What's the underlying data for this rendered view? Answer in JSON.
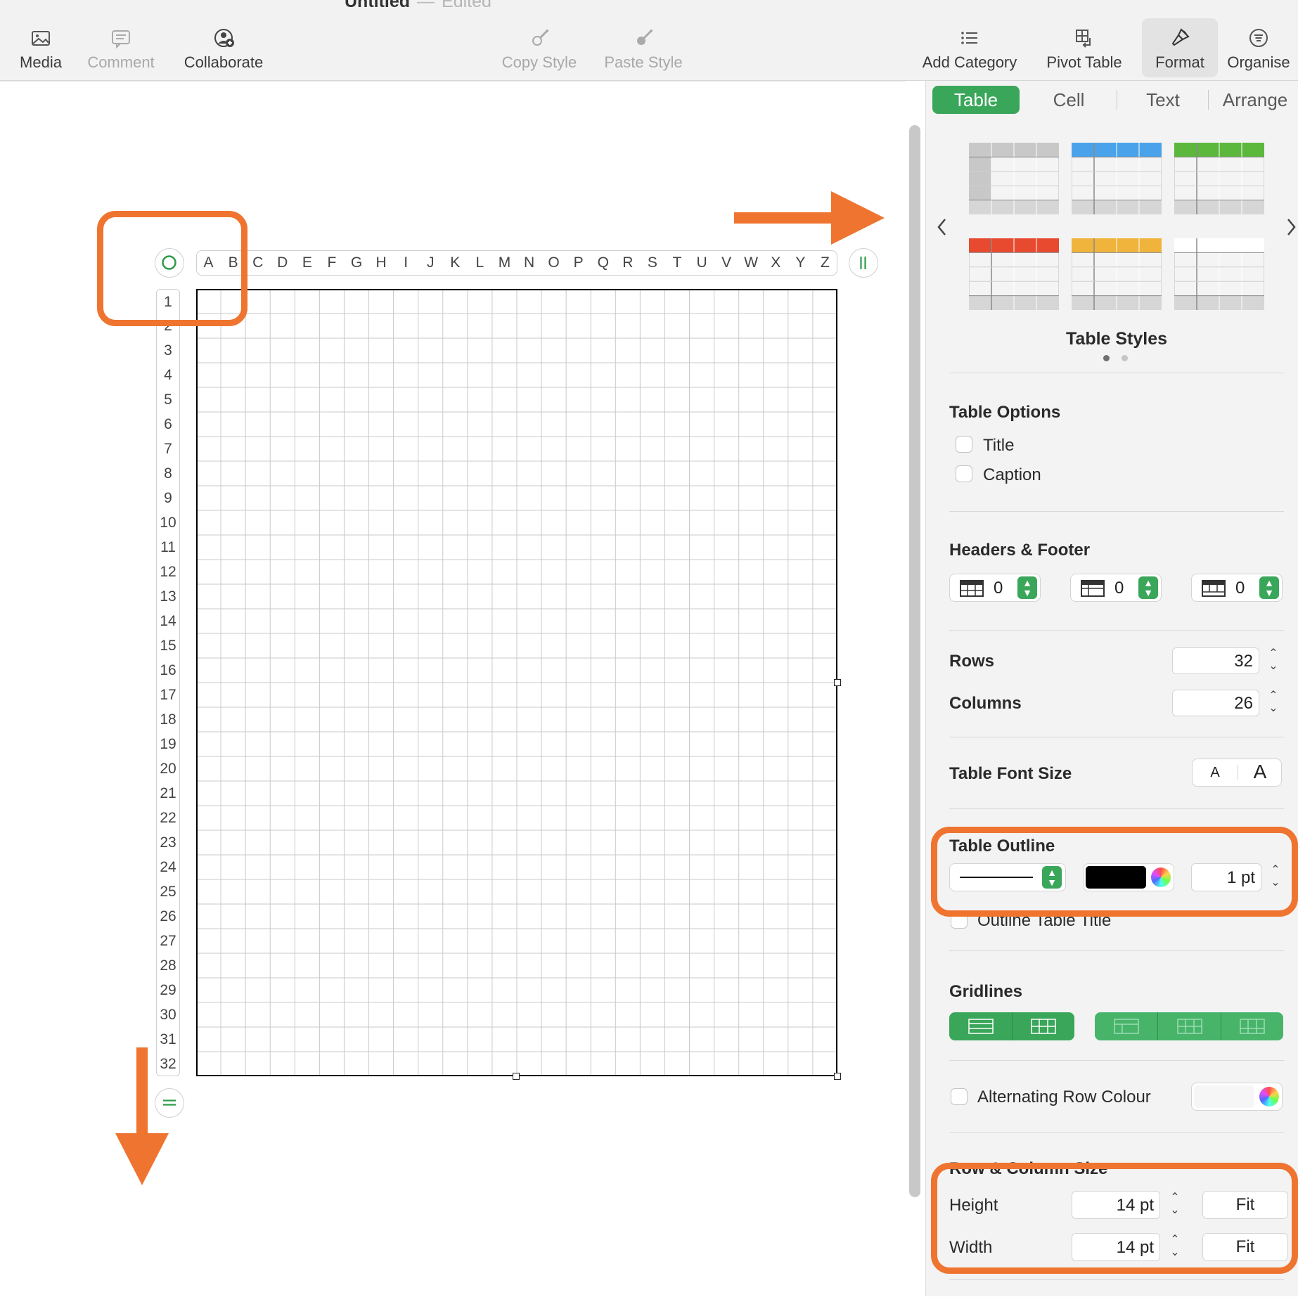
{
  "window": {
    "title": "Untitled",
    "separator": "—",
    "status": "Edited"
  },
  "toolbar": {
    "media": "Media",
    "comment": "Comment",
    "collaborate": "Collaborate",
    "copy_style": "Copy Style",
    "paste_style": "Paste Style",
    "add_category": "Add Category",
    "pivot_table": "Pivot Table",
    "format": "Format",
    "organise": "Organise"
  },
  "tabs": {
    "table": "Table",
    "cell": "Cell",
    "text": "Text",
    "arrange": "Arrange"
  },
  "columns": [
    "A",
    "B",
    "C",
    "D",
    "E",
    "F",
    "G",
    "H",
    "I",
    "J",
    "K",
    "L",
    "M",
    "N",
    "O",
    "P",
    "Q",
    "R",
    "S",
    "T",
    "U",
    "V",
    "W",
    "X",
    "Y",
    "Z"
  ],
  "rows": [
    "1",
    "2",
    "3",
    "4",
    "5",
    "6",
    "7",
    "8",
    "9",
    "10",
    "11",
    "12",
    "13",
    "14",
    "15",
    "16",
    "17",
    "18",
    "19",
    "20",
    "21",
    "22",
    "23",
    "24",
    "25",
    "26",
    "27",
    "28",
    "29",
    "30",
    "31",
    "32"
  ],
  "inspector": {
    "table_styles": "Table Styles",
    "style_header_colors": [
      "#c8c8c8",
      "#4aa3ea",
      "#5cb83c",
      "#e84a30",
      "#f0b43c",
      "#ffffff"
    ],
    "table_options": {
      "heading": "Table Options",
      "title": "Title",
      "caption": "Caption"
    },
    "headers_footer": {
      "heading": "Headers & Footer",
      "header_rows": "0",
      "header_columns": "0",
      "footer_rows": "0"
    },
    "rows_label": "Rows",
    "rows_value": "32",
    "columns_label": "Columns",
    "columns_value": "26",
    "font_size": {
      "label": "Table Font Size",
      "small": "A",
      "large": "A"
    },
    "outline": {
      "heading": "Table Outline",
      "color": "#000000",
      "width": "1 pt",
      "outline_title": "Outline Table Title"
    },
    "gridlines": {
      "heading": "Gridlines"
    },
    "alternating": {
      "label": "Alternating Row Colour"
    },
    "row_col_size": {
      "heading": "Row & Column Size",
      "height_label": "Height",
      "height_value": "14 pt",
      "height_fit": "Fit",
      "width_label": "Width",
      "width_value": "14 pt",
      "width_fit": "Fit"
    }
  },
  "accent_color": "#3aa65a",
  "annotation_color": "#ef7430"
}
